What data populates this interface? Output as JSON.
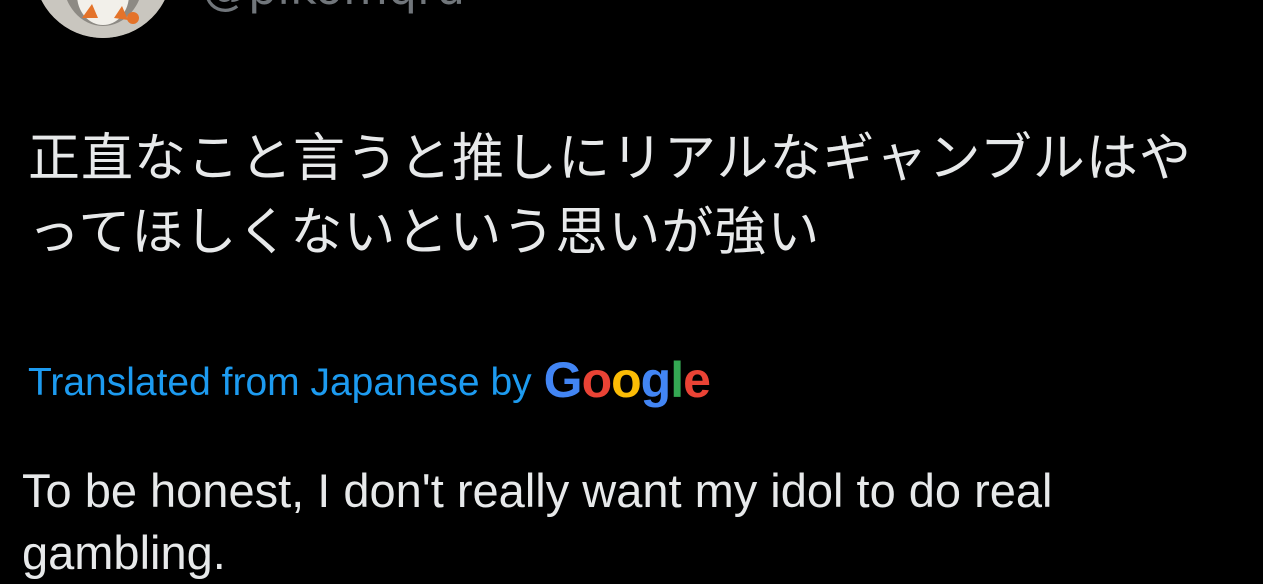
{
  "author": {
    "handle": "@pikomqru"
  },
  "tweet": {
    "original_text": "正直なこと言うと推しにリアルなギャンブルはやってほしくないという思いが強い",
    "translated_from_label": "Translated from Japanese by",
    "translation_provider": "Google",
    "translated_text": "To be honest, I don't really want my idol to do real gambling."
  },
  "colors": {
    "background": "#000000",
    "text": "#e7e9ea",
    "secondary_text": "#71767b",
    "link": "#1d9bf0",
    "google_blue": "#4285F4",
    "google_red": "#EA4335",
    "google_yellow": "#FBBC05",
    "google_green": "#34A853"
  }
}
